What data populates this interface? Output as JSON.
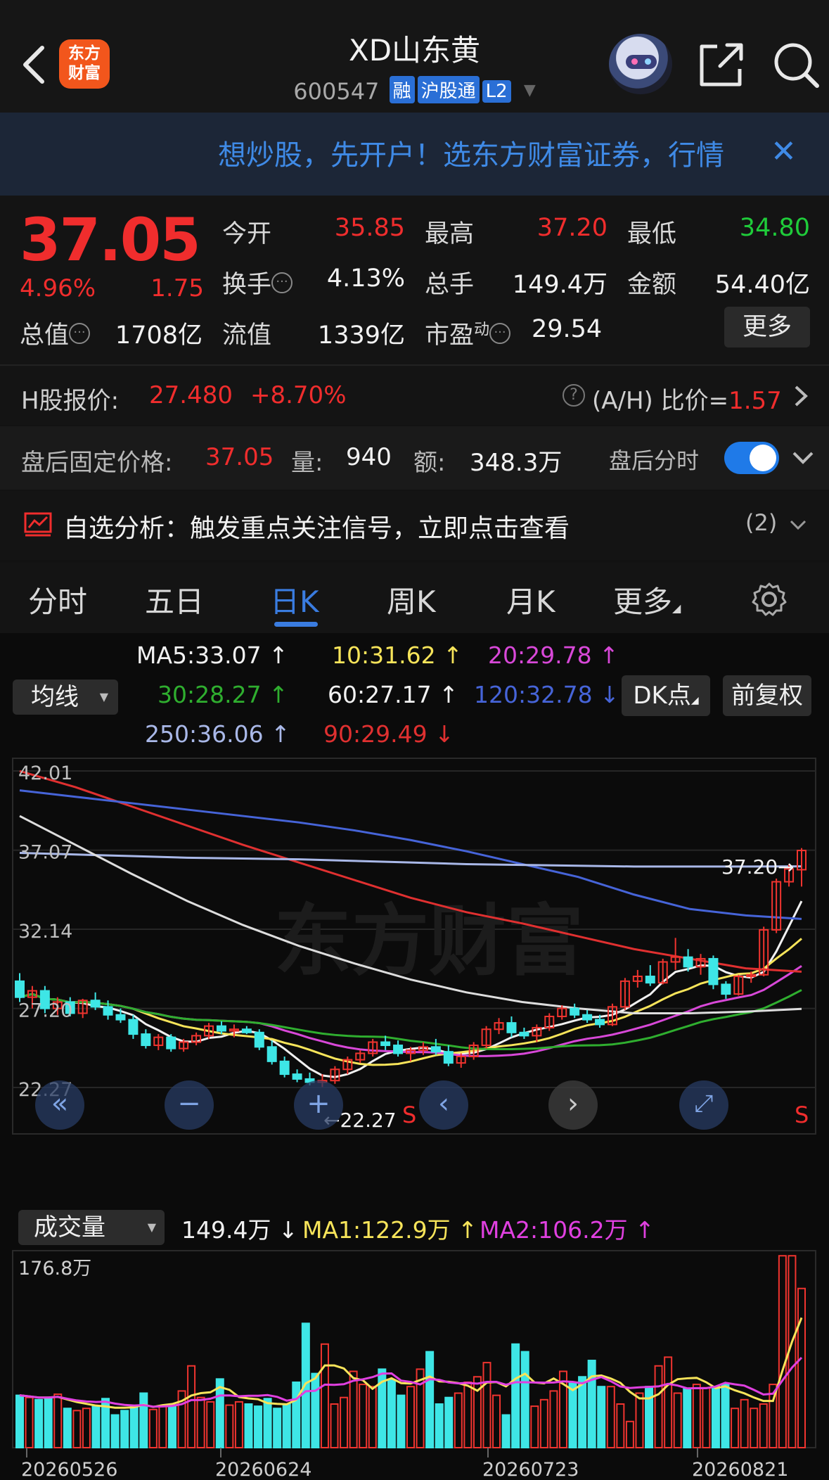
{
  "header": {
    "logo_line1": "东方",
    "logo_line2": "财富",
    "title": "XD山东黄",
    "code": "600547",
    "tags": [
      "融",
      "沪股通",
      "L2"
    ],
    "accent": "#2a6fd6"
  },
  "banner": {
    "text": "想炒股，先开户！选东方财富证券，行情",
    "close": "✕"
  },
  "quote": {
    "price": "37.05",
    "change_pct": "4.96%",
    "change": "1.75",
    "open_label": "今开",
    "open": "35.85",
    "high_label": "最高",
    "high": "37.20",
    "low_label": "最低",
    "low": "34.80",
    "turnover_label": "换手",
    "turnover": "4.13%",
    "volume_label": "总手",
    "volume": "149.4万",
    "amount_label": "金额",
    "amount": "54.40亿",
    "mktcap_label": "总值",
    "mktcap": "1708亿",
    "float_label": "流值",
    "float": "1339亿",
    "pe_label": "市盈",
    "pe_sup": "动",
    "pe": "29.54",
    "more": "更多",
    "up_color": "#f02d2d",
    "down_color": "#1fcc3a"
  },
  "h_share": {
    "label": "H股报价:",
    "price": "27.480",
    "pct": "+8.70%",
    "ratio_label": "(A/H) 比价=",
    "ratio": "1.57"
  },
  "after_hours": {
    "label": "盘后固定价格:",
    "price": "37.05",
    "vol_label": "量:",
    "vol": "940",
    "amt_label": "额:",
    "amt": "348.3万",
    "toggle_label": "盘后分时",
    "toggle_on": true
  },
  "analysis": {
    "text": "自选分析：触发重点关注信号，立即点击查看",
    "count": "(2)"
  },
  "tabs": [
    "分时",
    "五日",
    "日K",
    "周K",
    "月K",
    "更多"
  ],
  "active_tab": "日K",
  "ma": {
    "selector": "均线",
    "ma5": "MA5:33.07",
    "ma10": "10:31.62",
    "ma20": "20:29.78",
    "ma30": "30:28.27",
    "ma60": "60:27.17",
    "ma120": "120:32.78",
    "ma250": "250:36.06",
    "ma90": "90:29.49",
    "dk_button": "DK点",
    "adjust_button": "前复权"
  },
  "volume_panel": {
    "selector": "成交量",
    "value": "149.4万",
    "ma1": "MA1:122.9万",
    "ma2": "MA2:106.2万"
  },
  "chart_data": {
    "type": "candlestick",
    "price_axis": [
      "42.01",
      "37.07",
      "32.14",
      "27.20",
      "22.27"
    ],
    "ylim": [
      22.27,
      42.01
    ],
    "max_label": "37.20",
    "min_label": "22.27",
    "volume_axis_max": "176.8万",
    "dates": [
      "20260526",
      "20260624",
      "20260723",
      "20260821"
    ],
    "signal_marks": [
      "S",
      "S"
    ],
    "watermark": "东方财富",
    "candles": [
      [
        28.9,
        29.4,
        27.6,
        27.9
      ],
      [
        27.9,
        28.6,
        27.2,
        28.3
      ],
      [
        28.3,
        28.6,
        26.9,
        27.2
      ],
      [
        27.2,
        27.9,
        26.8,
        27.6
      ],
      [
        27.6,
        27.9,
        26.7,
        26.9
      ],
      [
        26.9,
        27.8,
        26.6,
        27.7
      ],
      [
        27.7,
        28.2,
        27.1,
        27.3
      ],
      [
        27.3,
        27.7,
        26.5,
        26.8
      ],
      [
        26.8,
        27.2,
        26.3,
        26.5
      ],
      [
        26.5,
        26.8,
        25.3,
        25.6
      ],
      [
        25.6,
        25.9,
        24.7,
        24.9
      ],
      [
        24.9,
        25.6,
        24.6,
        25.4
      ],
      [
        25.4,
        25.6,
        24.5,
        24.7
      ],
      [
        24.7,
        25.3,
        24.5,
        25.1
      ],
      [
        25.1,
        25.7,
        24.9,
        25.5
      ],
      [
        25.5,
        26.3,
        25.3,
        26.1
      ],
      [
        26.1,
        26.4,
        25.6,
        25.8
      ],
      [
        25.8,
        26.2,
        25.4,
        25.9
      ],
      [
        25.9,
        26.1,
        25.6,
        25.7
      ],
      [
        25.7,
        25.9,
        24.6,
        24.8
      ],
      [
        24.8,
        25.2,
        23.7,
        23.9
      ],
      [
        23.9,
        24.2,
        22.9,
        23.1
      ],
      [
        23.1,
        23.4,
        22.6,
        22.8
      ],
      [
        22.8,
        23.2,
        22.4,
        22.6
      ],
      [
        22.6,
        23.1,
        22.3,
        22.7
      ],
      [
        22.7,
        23.6,
        22.5,
        23.4
      ],
      [
        23.4,
        24.2,
        23.1,
        24.0
      ],
      [
        24.0,
        24.6,
        23.8,
        24.4
      ],
      [
        24.4,
        25.3,
        24.2,
        25.1
      ],
      [
        25.1,
        25.5,
        24.6,
        24.9
      ],
      [
        24.9,
        25.2,
        24.2,
        24.4
      ],
      [
        24.4,
        24.8,
        23.9,
        24.6
      ],
      [
        24.6,
        25.1,
        24.3,
        24.8
      ],
      [
        24.8,
        25.3,
        24.3,
        24.5
      ],
      [
        24.5,
        24.9,
        23.6,
        23.8
      ],
      [
        23.8,
        24.4,
        23.5,
        24.2
      ],
      [
        24.2,
        25.1,
        24.0,
        24.9
      ],
      [
        24.9,
        26.1,
        24.7,
        25.9
      ],
      [
        25.9,
        26.6,
        25.6,
        26.3
      ],
      [
        26.3,
        26.7,
        25.4,
        25.7
      ],
      [
        25.7,
        26.0,
        25.3,
        25.5
      ],
      [
        25.5,
        26.2,
        25.1,
        26.0
      ],
      [
        26.0,
        26.9,
        25.8,
        26.7
      ],
      [
        26.7,
        27.4,
        26.5,
        27.2
      ],
      [
        27.2,
        27.5,
        26.6,
        26.8
      ],
      [
        26.8,
        27.1,
        26.3,
        26.5
      ],
      [
        26.5,
        26.8,
        26.0,
        26.2
      ],
      [
        26.2,
        27.5,
        26.1,
        27.3
      ],
      [
        27.3,
        29.1,
        27.1,
        28.9
      ],
      [
        28.9,
        29.6,
        28.5,
        29.2
      ],
      [
        29.2,
        29.9,
        28.6,
        28.8
      ],
      [
        28.8,
        30.3,
        28.7,
        30.1
      ],
      [
        30.1,
        31.6,
        29.6,
        30.4
      ],
      [
        30.4,
        30.9,
        29.5,
        29.8
      ],
      [
        29.8,
        30.6,
        29.3,
        30.3
      ],
      [
        30.3,
        30.5,
        28.4,
        28.7
      ],
      [
        28.7,
        28.9,
        27.8,
        28.1
      ],
      [
        28.1,
        29.3,
        28.0,
        29.2
      ],
      [
        29.2,
        29.5,
        28.8,
        29.3
      ],
      [
        29.3,
        32.3,
        29.2,
        32.1
      ],
      [
        32.1,
        35.3,
        31.9,
        35.1
      ],
      [
        35.1,
        36.2,
        34.8,
        35.9
      ],
      [
        35.85,
        37.2,
        34.8,
        37.05
      ]
    ],
    "volumes_wan": [
      48,
      46,
      44,
      46,
      49,
      36,
      34,
      36,
      38,
      45,
      30,
      34,
      38,
      50,
      35,
      38,
      39,
      52,
      75,
      46,
      42,
      63,
      39,
      42,
      40,
      38,
      45,
      36,
      40,
      60,
      114,
      68,
      95,
      40,
      46,
      70,
      58,
      56,
      72,
      62,
      48,
      56,
      72,
      88,
      40,
      46,
      50,
      60,
      65,
      78,
      48,
      30,
      95,
      88,
      38,
      44,
      52,
      70,
      60,
      65,
      80,
      56,
      56,
      40,
      24,
      50,
      56,
      75,
      83,
      50,
      54,
      58,
      55,
      56,
      58,
      36,
      44,
      36,
      40,
      58,
      176,
      176,
      146
    ],
    "volume_colors": "red=up, cyan=down"
  }
}
